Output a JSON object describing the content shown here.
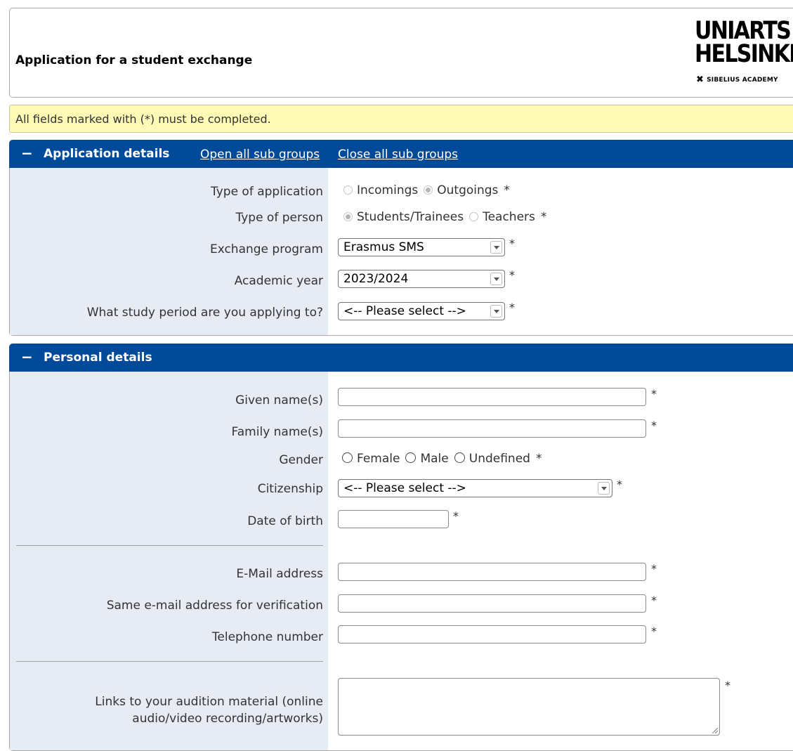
{
  "header": {
    "title": "Application for a student exchange",
    "logo": {
      "line1": "UNIARTS",
      "line2": "HELSINKI",
      "subtitle": "SIBELIUS ACADEMY"
    }
  },
  "info": {
    "text": "All fields marked with (*) must be completed."
  },
  "application_details": {
    "title": "Application details",
    "collapse_icon": "−",
    "open_all": "Open all sub groups",
    "close_all": "Close all sub groups",
    "type_of_application": {
      "label": "Type of application",
      "options": [
        "Incomings",
        "Outgoings"
      ],
      "selected": "Outgoings"
    },
    "type_of_person": {
      "label": "Type of person",
      "options": [
        "Students/Trainees",
        "Teachers"
      ],
      "selected": "Students/Trainees"
    },
    "exchange_program": {
      "label": "Exchange program",
      "value": "Erasmus SMS"
    },
    "academic_year": {
      "label": "Academic year",
      "value": "2023/2024"
    },
    "study_period": {
      "label": "What study period are you applying to?",
      "value": "<-- Please select -->"
    }
  },
  "personal_details": {
    "title": "Personal details",
    "collapse_icon": "−",
    "given_names": {
      "label": "Given name(s)",
      "value": ""
    },
    "family_names": {
      "label": "Family name(s)",
      "value": ""
    },
    "gender": {
      "label": "Gender",
      "options": [
        "Female",
        "Male",
        "Undefined"
      ]
    },
    "citizenship": {
      "label": "Citizenship",
      "value": "<-- Please select -->"
    },
    "date_of_birth": {
      "label": "Date of birth",
      "value": ""
    },
    "email": {
      "label": "E-Mail address",
      "value": ""
    },
    "email_verify": {
      "label": "Same e-mail address for verification",
      "value": ""
    },
    "telephone": {
      "label": "Telephone number",
      "value": ""
    },
    "audition_links": {
      "label_line1": "Links to your audition material (online",
      "label_line2": "audio/video recording/artworks)",
      "value": ""
    }
  },
  "required_marker": "*"
}
